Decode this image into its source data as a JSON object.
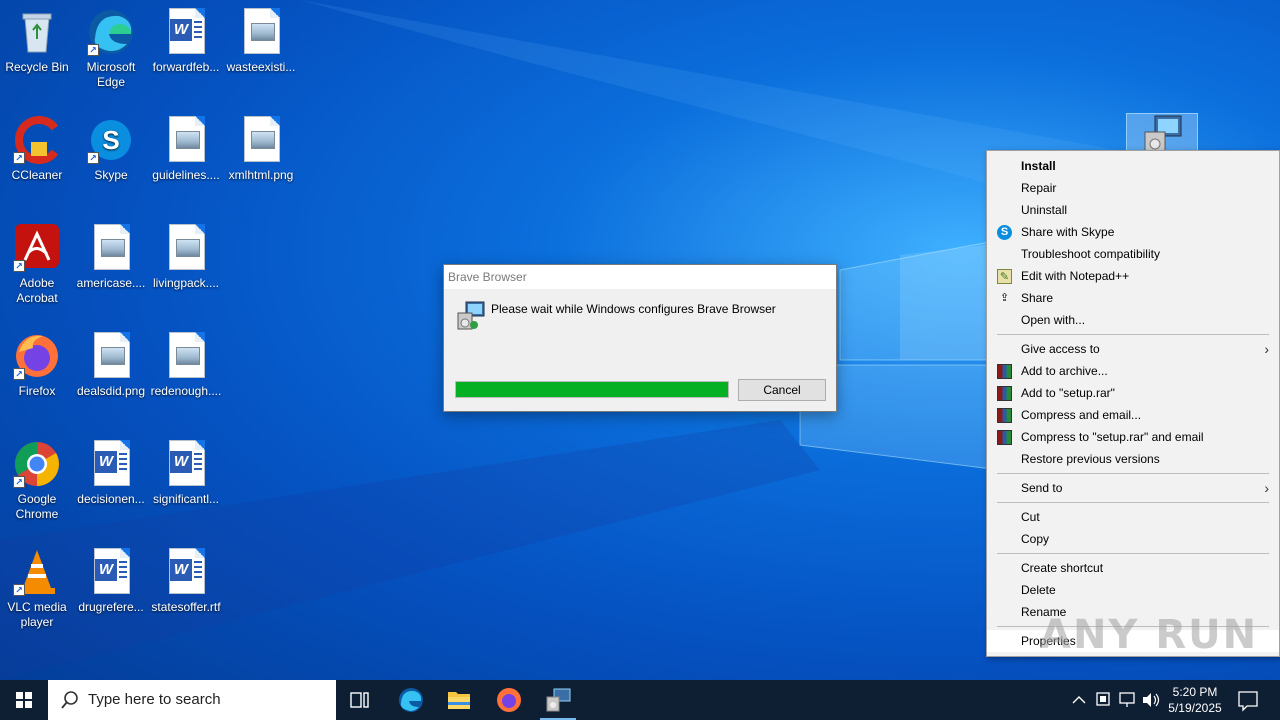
{
  "desktop": {
    "icons": [
      {
        "label": "Recycle Bin"
      },
      {
        "label": "Microsoft Edge"
      },
      {
        "label": "forwardfeb..."
      },
      {
        "label": "wasteexisti..."
      },
      {
        "label": "CCleaner"
      },
      {
        "label": "Skype"
      },
      {
        "label": "guidelines...."
      },
      {
        "label": "xmlhtml.png"
      },
      {
        "label": "Adobe Acrobat"
      },
      {
        "label": "americase...."
      },
      {
        "label": "livingpack...."
      },
      {
        "label": "Firefox"
      },
      {
        "label": "dealsdid.png"
      },
      {
        "label": "redenough...."
      },
      {
        "label": "Google Chrome"
      },
      {
        "label": "decisionen..."
      },
      {
        "label": "significantl..."
      },
      {
        "label": "VLC media player"
      },
      {
        "label": "drugrefere..."
      },
      {
        "label": "statesoffer.rtf"
      }
    ]
  },
  "dialog": {
    "title": "Brave Browser",
    "message": "Please wait while Windows configures Brave Browser",
    "progress": 1.0,
    "cancel_label": "Cancel",
    "progress_color": "#06b025"
  },
  "context_menu": {
    "items": [
      {
        "label": "Install"
      },
      {
        "label": "Repair"
      },
      {
        "label": "Uninstall"
      },
      {
        "label": "Share with Skype"
      },
      {
        "label": "Troubleshoot compatibility"
      },
      {
        "label": "Edit with Notepad++"
      },
      {
        "label": "Share"
      },
      {
        "label": "Open with..."
      },
      {
        "label": "Give access to"
      },
      {
        "label": "Add to archive..."
      },
      {
        "label": "Add to \"setup.rar\""
      },
      {
        "label": "Compress and email..."
      },
      {
        "label": "Compress to \"setup.rar\" and email"
      },
      {
        "label": "Restore previous versions"
      },
      {
        "label": "Send to"
      },
      {
        "label": "Cut"
      },
      {
        "label": "Copy"
      },
      {
        "label": "Create shortcut"
      },
      {
        "label": "Delete"
      },
      {
        "label": "Rename"
      },
      {
        "label": "Properties"
      }
    ]
  },
  "taskbar": {
    "search_placeholder": "Type here to search",
    "time": "5:20 PM",
    "date": "5/19/2025"
  },
  "watermark": "ANY RUN"
}
